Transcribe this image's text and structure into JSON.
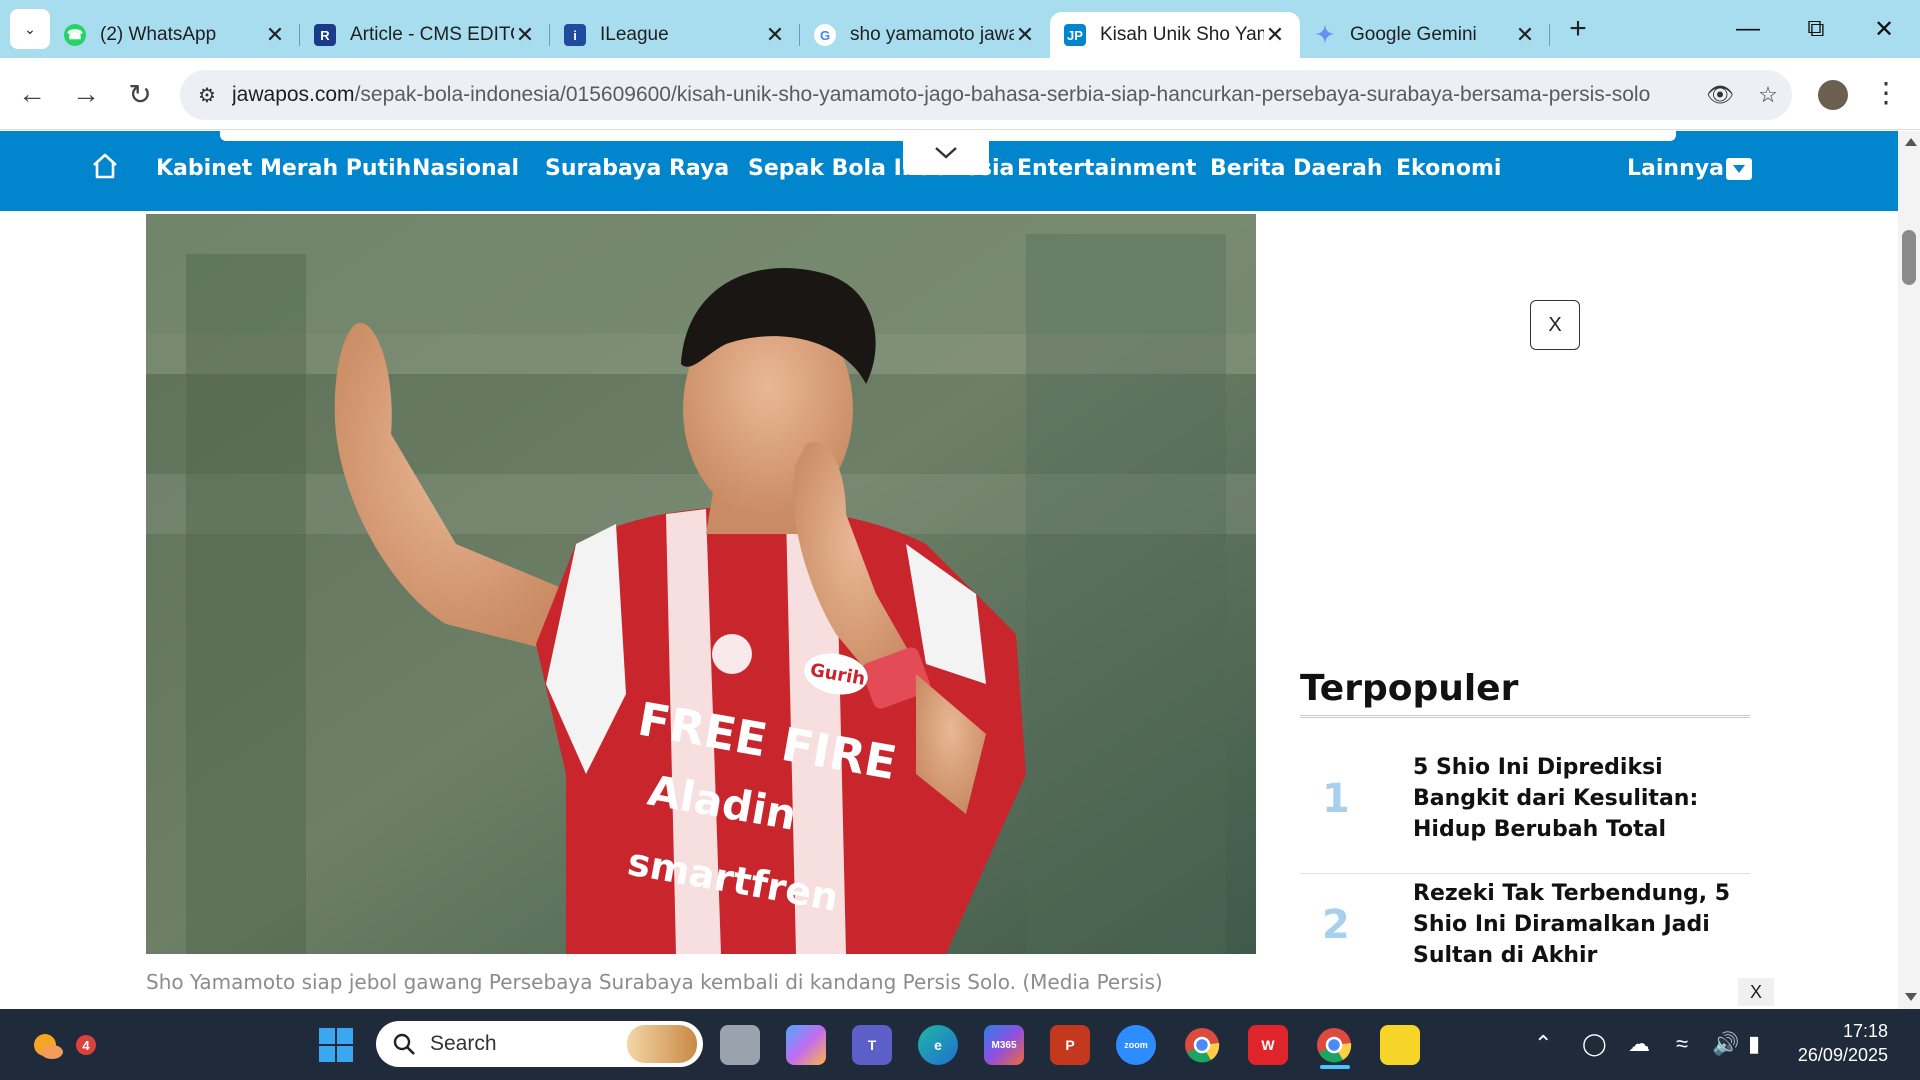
{
  "tabs": [
    {
      "title": "(2) WhatsApp",
      "icon": "whatsapp-icon",
      "color": "#25D366"
    },
    {
      "title": "Article - CMS EDITOR",
      "icon": "cms-icon",
      "color": "#1a3a8a"
    },
    {
      "title": "ILeague",
      "icon": "ileague-icon",
      "color": "#1e4aa0"
    },
    {
      "title": "sho yamamoto jawapos",
      "icon": "google-icon",
      "color": "#4285F4"
    },
    {
      "title": "Kisah Unik Sho Yamamoto",
      "icon": "jawapos-icon",
      "color": "#0185cd"
    },
    {
      "title": "Google Gemini",
      "icon": "gemini-icon",
      "color": "#6d8bf5"
    }
  ],
  "address_bar": {
    "domain": "jawapos.com",
    "path": "/sepak-bola-indonesia/015609600/kisah-unik-sho-yamamoto-jago-bahasa-serbia-siap-hancurkan-persebaya-surabaya-bersama-persis-solo"
  },
  "site_nav": {
    "items": [
      "Kabinet Merah Putih",
      "Nasional",
      "Surabaya Raya",
      "Sepak Bola Indonesia",
      "Entertainment",
      "Berita Daerah",
      "Ekonomi"
    ],
    "more_label": "Lainnya"
  },
  "article": {
    "caption": "Sho Yamamoto siap jebol gawang Persebaya Surabaya kembali di kandang Persis Solo. (Media Persis)",
    "jersey_text": [
      "FREE FIRE",
      "Aladin",
      "smartfren",
      "Gurih"
    ]
  },
  "ad": {
    "close_label": "X"
  },
  "popular": {
    "title": "Terpopuler",
    "items": [
      {
        "rank": "1",
        "text": "5 Shio Ini Diprediksi Bangkit dari Kesulitan: Hidup Berubah Total hingga Jadi…"
      },
      {
        "rank": "2",
        "text": "Rezeki Tak Terbendung, 5 Shio Ini Diramalkan Jadi Sultan di Akhir September…"
      }
    ],
    "bottom_close": "X"
  },
  "taskbar": {
    "search_label": "Search",
    "weather_badge": "4",
    "zoom_label": "zoom",
    "m365_label": "M365",
    "time": "17:18",
    "date": "26/09/2025"
  },
  "colors": {
    "tabbar": "#a8ddef",
    "brand_blue": "#0185cd",
    "taskbar": "#1f2a3a"
  }
}
